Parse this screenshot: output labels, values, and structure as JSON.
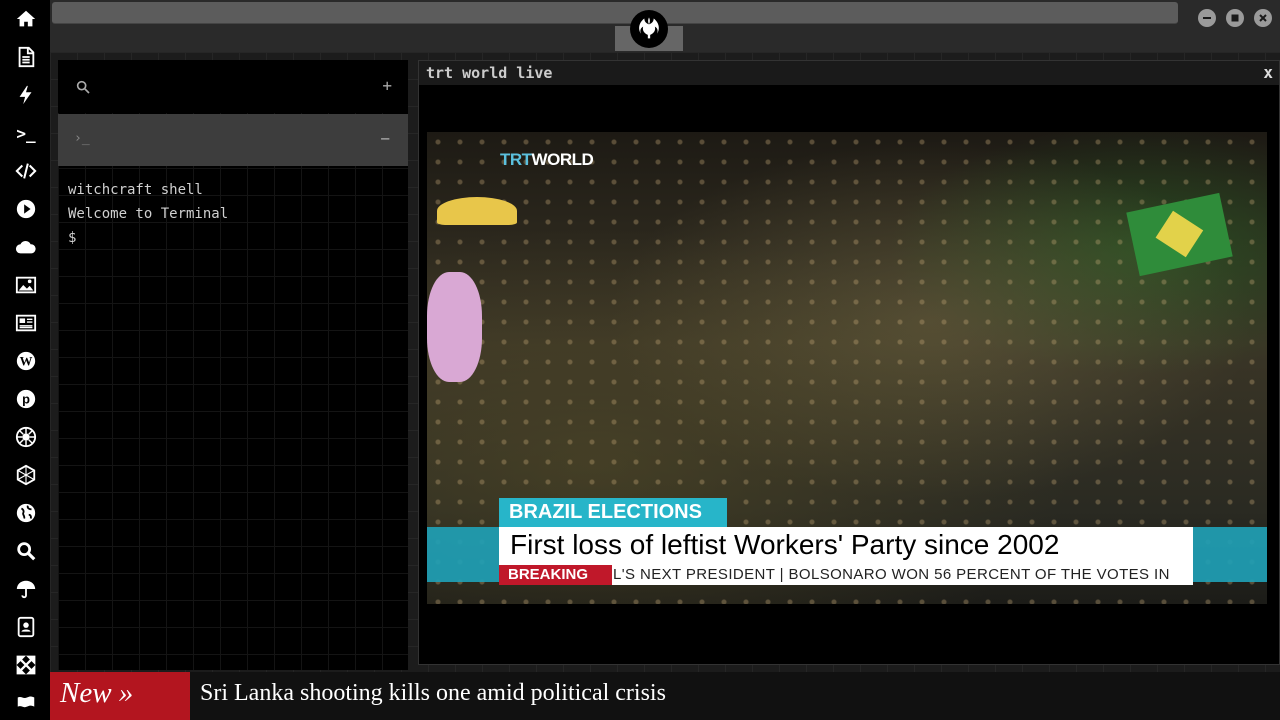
{
  "sidebar": {
    "items": [
      {
        "icon": "home-icon"
      },
      {
        "icon": "document-icon"
      },
      {
        "icon": "lightning-icon"
      },
      {
        "icon": "terminal-icon"
      },
      {
        "icon": "code-icon"
      },
      {
        "icon": "play-icon"
      },
      {
        "icon": "cloud-icon"
      },
      {
        "icon": "image-icon"
      },
      {
        "icon": "newspaper-icon"
      },
      {
        "icon": "wordpress-icon"
      },
      {
        "icon": "pinterest-icon"
      },
      {
        "icon": "empire-icon"
      },
      {
        "icon": "hexagon-icon"
      },
      {
        "icon": "globe-icon"
      },
      {
        "icon": "search-icon"
      },
      {
        "icon": "umbrella-icon"
      },
      {
        "icon": "contacts-icon"
      },
      {
        "icon": "expand-icon"
      },
      {
        "icon": "flag-icon"
      }
    ]
  },
  "topbar": {
    "logo": "rebel-alliance-icon",
    "window_controls": [
      "minimize",
      "maximize",
      "close"
    ]
  },
  "terminal": {
    "search_placeholder": "",
    "add_label": "+",
    "tab_prompt": "›_",
    "collapse_label": "−",
    "lines": [
      "witchcraft shell",
      "Welcome to Terminal",
      "$"
    ]
  },
  "video": {
    "title": "trt world live",
    "close_label": "x",
    "channel_logo_prefix": "TRT",
    "channel_logo_suffix": "WORLD",
    "topic": "BRAZIL ELECTIONS",
    "headline": "First loss of leftist Workers' Party since 2002",
    "breaking_label": "BREAKING",
    "ticker": "L'S NEXT PRESIDENT   |   BOLSONARO WON 56 PERCENT OF THE VOTES IN"
  },
  "news": {
    "label": "New »",
    "headline": "Sri Lanka shooting kills one amid political crisis"
  },
  "colors": {
    "news_label_bg": "#b3151f",
    "topic_bg": "#27b5c9",
    "breaking_bg": "#c0182a"
  }
}
